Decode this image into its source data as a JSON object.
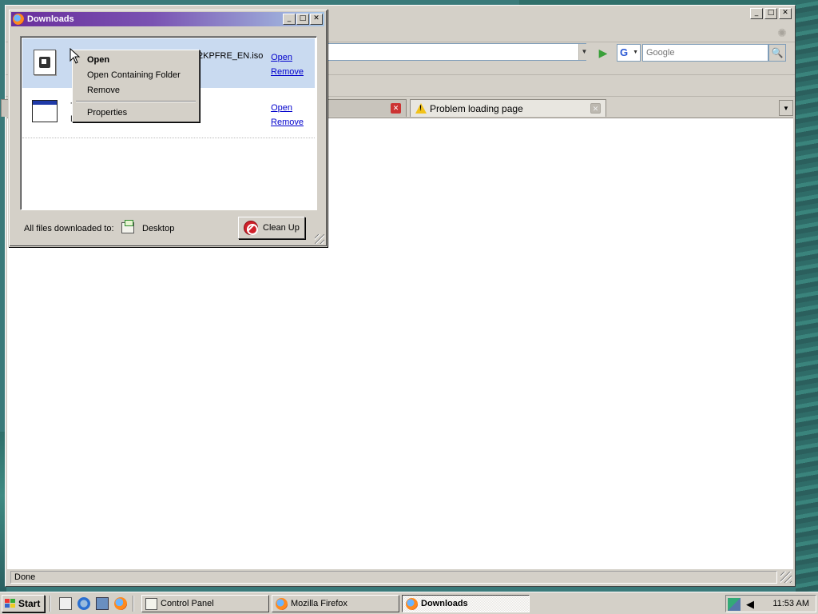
{
  "firefox": {
    "search_placeholder": "Google",
    "tabs": [
      {
        "title": ""
      },
      {
        "title": "Problem loading page"
      }
    ],
    "status": "Done"
  },
  "downloads": {
    "title": "Downloads",
    "items": [
      {
        "name": "2KPFRE_EN.iso",
        "open": "Open",
        "remove": "Remove",
        "icon": "iso-file-icon"
      },
      {
        "name": "7",
        "sub": "D",
        "open": "Open",
        "remove": "Remove",
        "icon": "application-icon"
      }
    ],
    "footer_label": "All files downloaded to:",
    "footer_folder": "Desktop",
    "cleanup": "Clean Up"
  },
  "context_menu": {
    "items": [
      "Open",
      "Open Containing Folder",
      "Remove",
      "Properties"
    ]
  },
  "taskbar": {
    "start": "Start",
    "buttons": [
      "Control Panel",
      "Mozilla Firefox",
      "Downloads"
    ],
    "clock": "11:53 AM"
  },
  "colors": {
    "titlebar_start": "#6a2f9c",
    "titlebar_end": "#a7c7e6",
    "link": "#0000cc",
    "selection": "#c9daf0"
  }
}
